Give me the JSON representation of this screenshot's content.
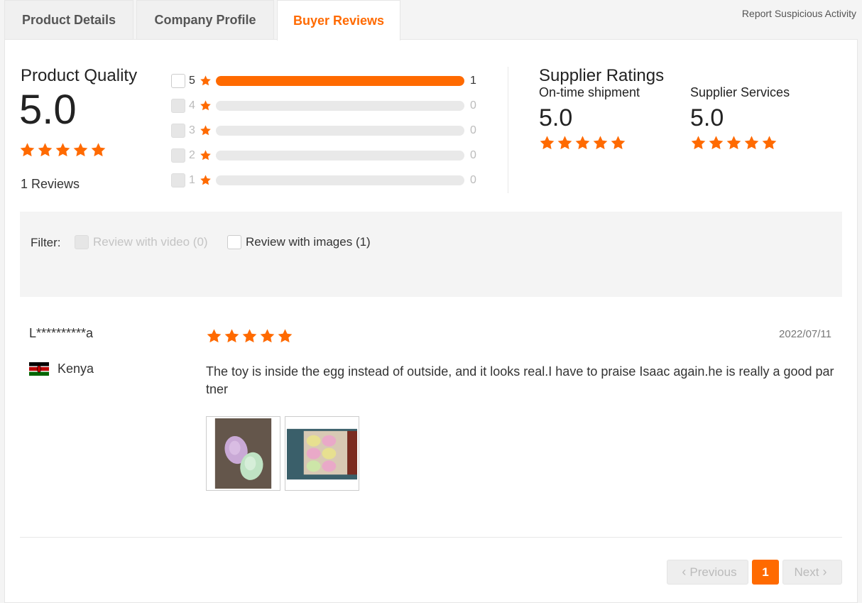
{
  "tabs": [
    {
      "label": "Product Details"
    },
    {
      "label": "Company Profile"
    },
    {
      "label": "Buyer Reviews",
      "active": true
    }
  ],
  "report_link": "Report Suspicious Activity",
  "product_quality": {
    "title": "Product Quality",
    "score": "5.0",
    "stars": 5,
    "reviews_count": "1 Reviews"
  },
  "distribution": [
    {
      "stars": "5",
      "count": "1",
      "fraction": 1.0
    },
    {
      "stars": "4",
      "count": "0",
      "fraction": 0
    },
    {
      "stars": "3",
      "count": "0",
      "fraction": 0
    },
    {
      "stars": "2",
      "count": "0",
      "fraction": 0
    },
    {
      "stars": "1",
      "count": "0",
      "fraction": 0
    }
  ],
  "supplier_ratings": {
    "title": "Supplier Ratings",
    "on_time": {
      "label": "On-time shipment",
      "score": "5.0",
      "stars": 5
    },
    "services": {
      "label": "Supplier Services",
      "score": "5.0",
      "stars": 5
    }
  },
  "filter": {
    "label": "Filter:",
    "video": "Review with video (0)",
    "images": "Review with images (1)"
  },
  "review": {
    "user": "L**********a",
    "country": "Kenya",
    "date": "2022/07/11",
    "stars": 5,
    "text": "The toy is inside the egg instead of outside, and it looks real.I have to praise Isaac again.he is really a good partner"
  },
  "pagination": {
    "previous": "Previous",
    "current": "1",
    "next": "Next"
  },
  "colors": {
    "accent": "#ff6a00",
    "bar_track": "#e9e9e9"
  },
  "icons": [
    "star-icon",
    "chevron-left-icon",
    "chevron-right-icon",
    "kenya-flag-icon"
  ]
}
